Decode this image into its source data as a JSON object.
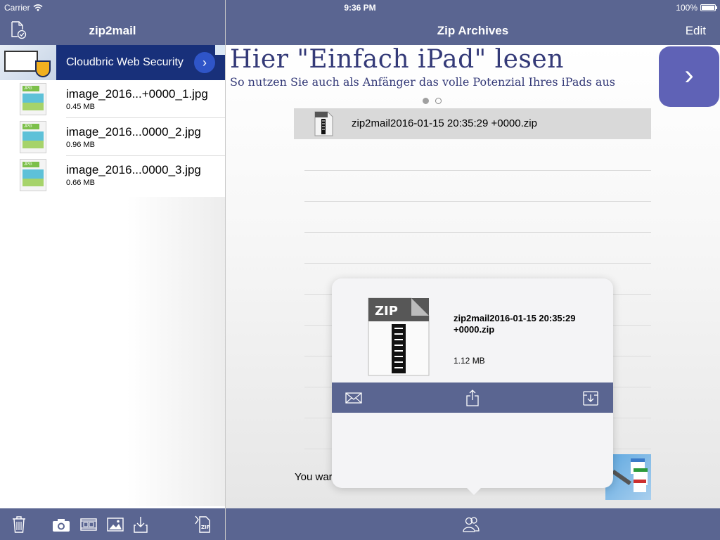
{
  "status_bar": {
    "carrier": "Carrier",
    "time": "9:36 PM",
    "battery": "100%"
  },
  "left_nav": {
    "title": "zip2mail",
    "doc_icon": "document-check-icon"
  },
  "ad": {
    "text": "Cloudbric Web Security",
    "go_icon": "chevron-right-icon",
    "choices_icon": "adchoices-icon"
  },
  "files": [
    {
      "name": "image_2016...+0000_1.jpg",
      "size": "0.45 MB"
    },
    {
      "name": "image_2016...0000_2.jpg",
      "size": "0.96 MB"
    },
    {
      "name": "image_2016...0000_3.jpg",
      "size": "0.66 MB"
    }
  ],
  "left_toolbar": {
    "icons": [
      "trash-icon",
      "camera-icon",
      "film-strip-icon",
      "photo-icon",
      "download-icon",
      "zip-document-icon"
    ]
  },
  "right_nav": {
    "title": "Zip Archives",
    "edit": "Edit"
  },
  "promo": {
    "headline": "Hier \"Einfach iPad\" lesen",
    "subline": "So nutzen Sie auch als Anfänger das volle Potenzial Ihres iPads aus",
    "page_indicator": {
      "count": 2,
      "active": 1
    }
  },
  "archives": [
    {
      "name": "zip2mail2016-01-15 20:35:29 +0000.zip"
    }
  ],
  "zip_icon_label": "ZIP",
  "bottom_text": "You war",
  "popover": {
    "name": "zip2mail2016-01-15 20:35:29 +0000.zip",
    "size": "1.12 MB",
    "actions": [
      "mail-icon",
      "share-icon",
      "archive-download-icon"
    ]
  },
  "right_toolbar": {
    "icon": "people-icon"
  },
  "colors": {
    "bar": "#5a6591",
    "ad_bg": "#18307a",
    "promo_text": "#343a78",
    "promo_button": "#5f62b6"
  }
}
